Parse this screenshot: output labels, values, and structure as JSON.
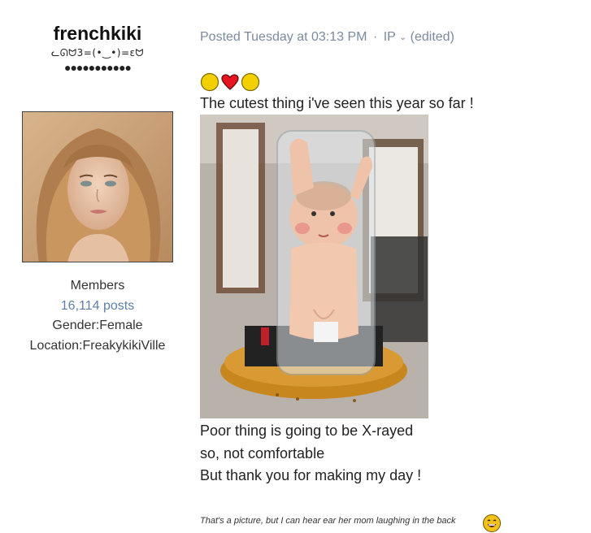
{
  "author": {
    "name": "frenchkiki",
    "title": "ᓚᘏᗢ3=(•‿•)=εᗢ",
    "rank_dots": "●●●●●●●●●●●",
    "group": "Members",
    "posts": "16,114 posts",
    "gender": "Gender:Female",
    "location": "Location:FreakykikiVille"
  },
  "post": {
    "meta": {
      "posted": "Posted Tuesday at 03:13 PM",
      "separator": "·",
      "ip": "IP",
      "edited": "(edited)"
    },
    "emoji_icons": [
      "yellow-circle-icon",
      "red-heart-icon",
      "yellow-circle-icon"
    ],
    "line1": "The cutest thing i've seen this year so far !",
    "body_lines": [
      "Poor thing is going to be X-rayed",
      "so, not comfortable",
      "But thank you for making my day !"
    ],
    "signature": "That's a picture, but I can hear ear her mom laughing in the back"
  },
  "colors": {
    "meta_text": "#7c8aa0",
    "link": "#5f7ea8",
    "emoji_yellow": "#f2d000",
    "heart_red": "#e5161f"
  }
}
